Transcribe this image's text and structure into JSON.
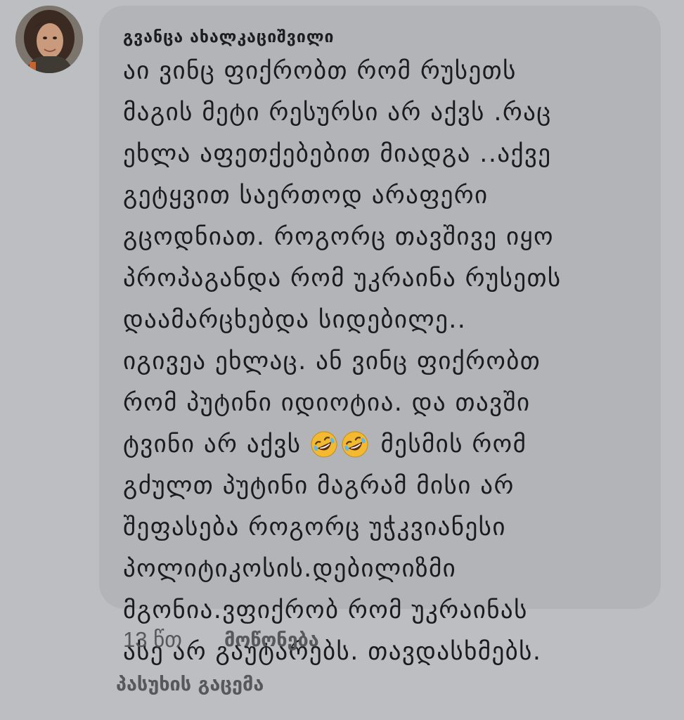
{
  "comment": {
    "author": "გვანცა ახალკაციშვილი",
    "avatar_icon": "profile-photo",
    "lines": {
      "l1": "აი ვინც ფიქრობთ რომ რუსეთს",
      "l2": "მაგის მეტი რესურსი არ აქვს .რაც",
      "l3": "ეხლა აფეთქებებით მიადგა ..აქვე",
      "l4": "გეტყვით საერთოდ არაფერი",
      "l5": "გცოდნიათ.  როგორც თავშივე იყო",
      "l6": "პროპაგანდა რომ უკრაინა რუსეთს",
      "l7": "დაამარცხებდა   სიდებილე..",
      "l8": "იგივეა ეხლაც.   ან ვინც ფიქრობთ",
      "l9": "რომ პუტინი იდიოტია. და  თავში",
      "l10_before": "ტვინი არ აქვს",
      "l10_after": "მესმის რომ",
      "l11": "გძულთ  პუტინი მაგრამ მისი არ",
      "l12": "შეფასება როგორც უჭკვიანესი",
      "l13": "პოლიტიკოსის.დებილიზმი",
      "l14": "მგონია.ვფიქრობ რომ უკრაინას",
      "l15": "ასე არ გაუტარებს.  თავდასხმებს."
    },
    "emoji": [
      "rolling-on-floor-laughing-emoji",
      "rolling-on-floor-laughing-emoji"
    ],
    "time": "13 წთ",
    "like_label": "მოწონება",
    "reply_label": "პასუხის გაცემა"
  },
  "colors": {
    "background": "#bcbec1",
    "bubble": "#b2b4b7",
    "text": "#1a1b1d",
    "meta_text": "#55585c",
    "emoji_face": "#f3b931"
  }
}
